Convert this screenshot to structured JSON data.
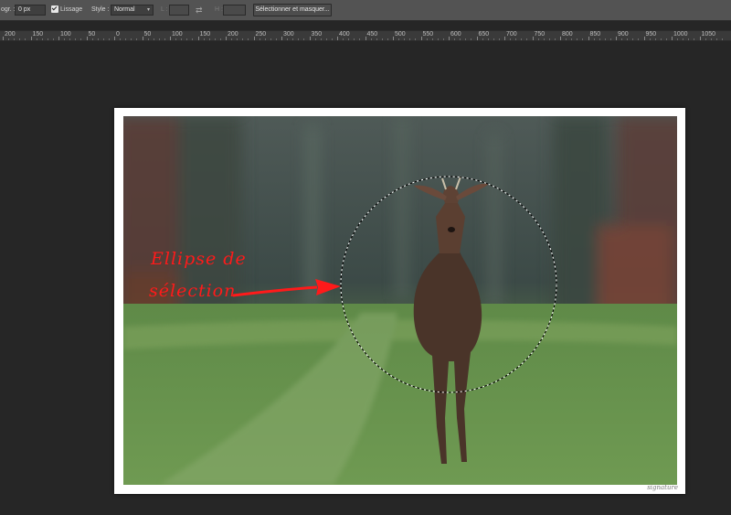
{
  "options_bar": {
    "feather_label": "ogr. :",
    "feather_value": "0 px",
    "antialias_label": "Lissage",
    "style_label": "Style :",
    "style_value": "Normal",
    "width_label": "L :",
    "height_label": "H :",
    "select_mask_button": "Sélectionner et masquer..."
  },
  "ruler": {
    "ticks": [
      "200",
      "150",
      "100",
      "50",
      "0",
      "50",
      "100",
      "150",
      "200",
      "250",
      "300",
      "350",
      "400",
      "450",
      "500",
      "550",
      "600",
      "650",
      "700",
      "750",
      "800",
      "850",
      "900",
      "950",
      "1000",
      "1050"
    ]
  },
  "annotation": {
    "line1": "Ellipse de",
    "line2": "sélection"
  },
  "colors": {
    "app_background": "#262626",
    "annotation_red": "#ff1a1a"
  }
}
